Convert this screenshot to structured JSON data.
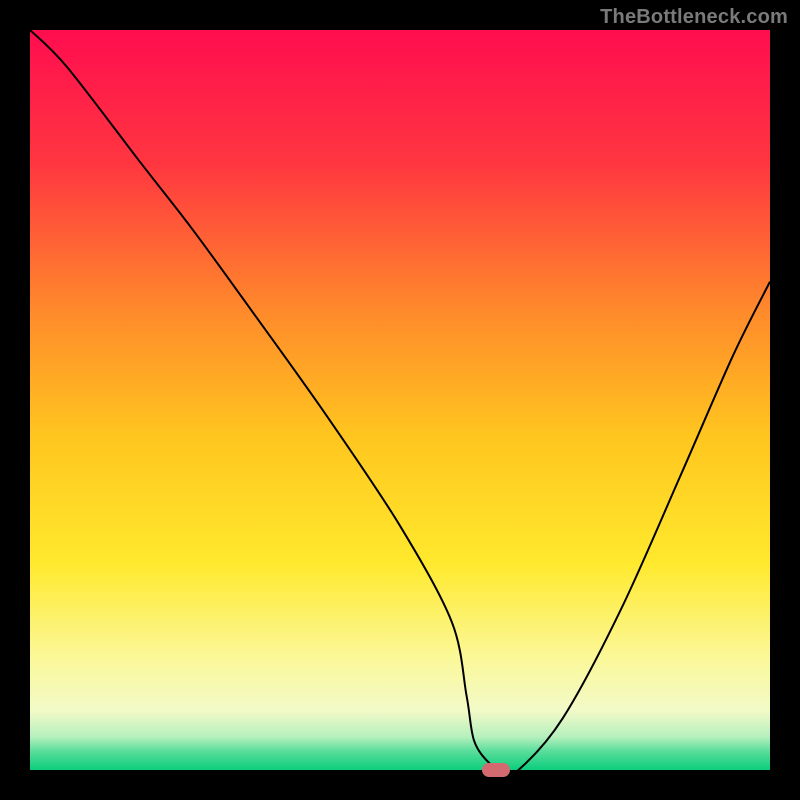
{
  "attribution": "TheBottleneck.com",
  "chart_data": {
    "type": "line",
    "title": "",
    "xlabel": "",
    "ylabel": "",
    "xlim": [
      0,
      100
    ],
    "ylim": [
      0,
      100
    ],
    "x": [
      0,
      5,
      15,
      22,
      30,
      40,
      50,
      57,
      59,
      60,
      62,
      64,
      66,
      72,
      80,
      88,
      95,
      100
    ],
    "values": [
      100,
      95,
      82,
      73,
      62,
      48,
      33,
      20,
      10,
      4,
      1,
      0,
      0,
      7,
      22,
      40,
      56,
      66
    ],
    "gradient_stops": [
      {
        "pos": 0.0,
        "color": "#ff0d4f"
      },
      {
        "pos": 0.18,
        "color": "#ff3640"
      },
      {
        "pos": 0.38,
        "color": "#ff8a2b"
      },
      {
        "pos": 0.55,
        "color": "#ffc61f"
      },
      {
        "pos": 0.72,
        "color": "#ffe92d"
      },
      {
        "pos": 0.85,
        "color": "#fbf89a"
      },
      {
        "pos": 0.92,
        "color": "#f2fac8"
      },
      {
        "pos": 0.955,
        "color": "#b6f0bd"
      },
      {
        "pos": 0.975,
        "color": "#58dd9a"
      },
      {
        "pos": 1.0,
        "color": "#0cce7d"
      }
    ],
    "marker": {
      "x": 63,
      "y": 0,
      "color": "#d36a6f"
    },
    "curve_color": "#000000",
    "curve_width": 2
  }
}
